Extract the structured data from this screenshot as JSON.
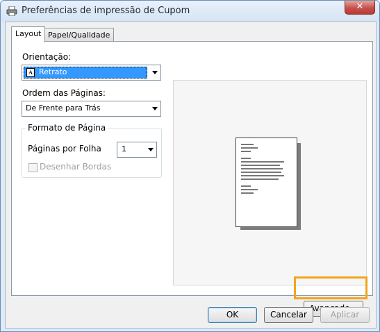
{
  "window": {
    "title": "Preferências de impressão de Cupom",
    "close_label": "✕"
  },
  "tabs": [
    {
      "label": "Layout",
      "active": true
    },
    {
      "label": "Papel/Qualidade",
      "active": false
    }
  ],
  "orientation": {
    "label": "Orientação:",
    "value": "Retrato"
  },
  "page_order": {
    "label": "Ordem das Páginas:",
    "value": "De Frente para Trás"
  },
  "page_format": {
    "legend": "Formato de Página",
    "pages_per_sheet_label": "Páginas por Folha",
    "pages_per_sheet_value": "1",
    "draw_borders_label": "Desenhar Bordas",
    "draw_borders_checked": false,
    "draw_borders_enabled": false
  },
  "buttons": {
    "advanced": "Avançado...",
    "ok": "OK",
    "cancel": "Cancelar",
    "apply": "Aplicar"
  },
  "colors": {
    "highlight": "#f2a51a",
    "selection": "#3399ff"
  }
}
